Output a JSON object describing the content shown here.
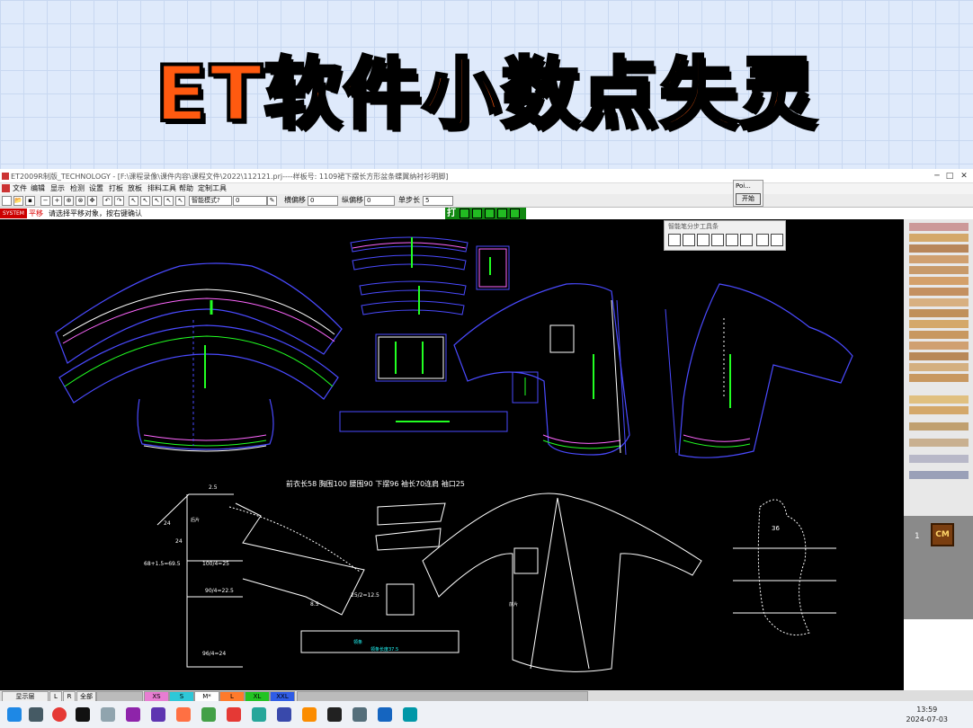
{
  "banner": {
    "title": "ET软件小数点失灵"
  },
  "window": {
    "title": "ET2009R制版_TECHNOLOGY - [F:\\课程录像\\课件内容\\课程文件\\2022\\112121.prj----样板号: 1109裙下摆长方形盆条蝶翼纳衬衫明脚]",
    "controls": [
      "─",
      "□",
      "✕"
    ]
  },
  "menu": [
    "文件",
    "编辑",
    "显示",
    "检测",
    "设置",
    "打板",
    "放板",
    "排料工具",
    "帮助",
    "定制工具"
  ],
  "toolbar": {
    "mode_select": "智能模式?",
    "mode_value": "0",
    "fields": [
      {
        "label": "横偏移",
        "value": "0"
      },
      {
        "label": "纵偏移",
        "value": "0"
      },
      {
        "label": "单步长",
        "value": "5"
      }
    ]
  },
  "status": {
    "tag": "SYSTEM",
    "mode": "平移",
    "hint": "请选择平移对象，按右键确认"
  },
  "green_toolbar": {
    "label": "打"
  },
  "popup": {
    "title": "Poi...",
    "button": "开始"
  },
  "float_panel": {
    "title": "智能笔分步工具条"
  },
  "drawing": {
    "measure_line": "前衣长58   胸围100   腰围90   下摆96   袖长70连肩   袖口25",
    "labels": [
      "2.5",
      "24",
      "24",
      "68+1.5=69.5",
      "100/4=25",
      "90/4=22.5",
      "96/4=24",
      "8.5",
      "25/2=12.5",
      "36",
      "领条",
      "领条长度37.5",
      "后片",
      "前片"
    ]
  },
  "right_panel": {
    "index": "1",
    "unit": "CM"
  },
  "bottom_bar": {
    "left_label": "显示层",
    "buttons": [
      "L",
      "R",
      "全部"
    ],
    "sizes": [
      {
        "label": "XS",
        "color": "#e87dd2"
      },
      {
        "label": "S",
        "color": "#2ec8d8"
      },
      {
        "label": "M*",
        "color": "#ffffff"
      },
      {
        "label": "L",
        "color": "#ff7a2b"
      },
      {
        "label": "XL",
        "color": "#22c322"
      },
      {
        "label": "XXL",
        "color": "#2f5ce6"
      }
    ]
  },
  "clock": {
    "time": "13:59",
    "date": "2024-07-03"
  }
}
